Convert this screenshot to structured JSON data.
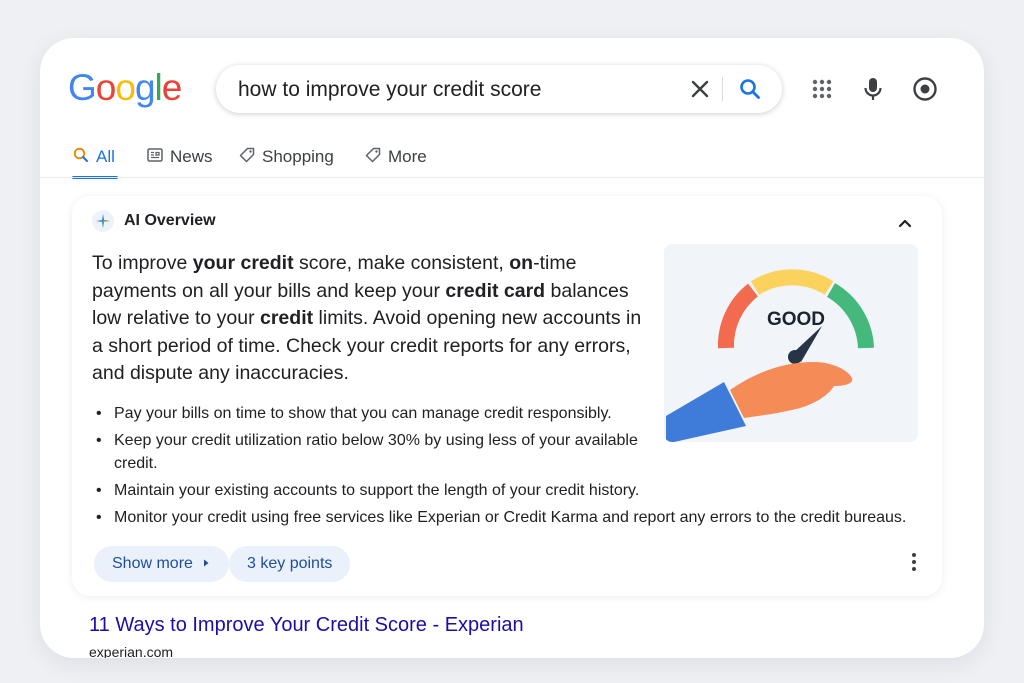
{
  "logo": {
    "letters": [
      {
        "char": "G",
        "color": "#4285F4"
      },
      {
        "char": "o",
        "color": "#EA4335"
      },
      {
        "char": "o",
        "color": "#FBBC05"
      },
      {
        "char": "g",
        "color": "#4285F4"
      },
      {
        "char": "l",
        "color": "#34A853"
      },
      {
        "char": "e",
        "color": "#EA4335"
      }
    ]
  },
  "search": {
    "query": "how to improve your credit score",
    "clear_icon": "close-icon",
    "search_icon": "search-icon"
  },
  "top_icons": [
    "apps-grid-icon",
    "microphone-icon",
    "lens-icon"
  ],
  "tabs": [
    {
      "label": "All",
      "icon": "search-icon",
      "active": true
    },
    {
      "label": "News",
      "icon": "news-icon",
      "active": false
    },
    {
      "label": "Shopping",
      "icon": "tag-icon",
      "active": false
    },
    {
      "label": "More",
      "icon": "tag-icon",
      "active": false
    }
  ],
  "ai_overview": {
    "title": "AI Overview",
    "summary_parts": [
      {
        "t": "To improve ",
        "b": false
      },
      {
        "t": "your credit",
        "b": true
      },
      {
        "t": " score, make consistent, ",
        "b": false
      },
      {
        "t": "on",
        "b": true
      },
      {
        "t": "-time payments on all your bills and keep your ",
        "b": false
      },
      {
        "t": "credit card",
        "b": true
      },
      {
        "t": " balances low relative to your ",
        "b": false
      },
      {
        "t": "credit",
        "b": true
      },
      {
        "t": " limits. Avoid opening new accounts in a short period of time. Check your credit reports for any errors, and dispute any inaccuracies.",
        "b": false
      }
    ],
    "bullets": [
      "Pay your bills on time to show that you can manage credit responsibly.",
      "Keep your credit utilization ratio below 30% by using less of your available credit.",
      "Maintain your existing accounts to support the length of your credit history.",
      "Monitor your credit using free services like Experian or Credit Karma and report any errors to the credit bureaus."
    ],
    "gauge_label": "GOOD",
    "show_more_label": "Show more",
    "key_points_label": "3 key points"
  },
  "result": {
    "title": "11 Ways to Improve Your Credit Score - Experian",
    "url": "experian.com"
  },
  "colors": {
    "accent": "#1a73e8",
    "link": "#1a0dab",
    "chip_bg": "#eaf1fb"
  }
}
